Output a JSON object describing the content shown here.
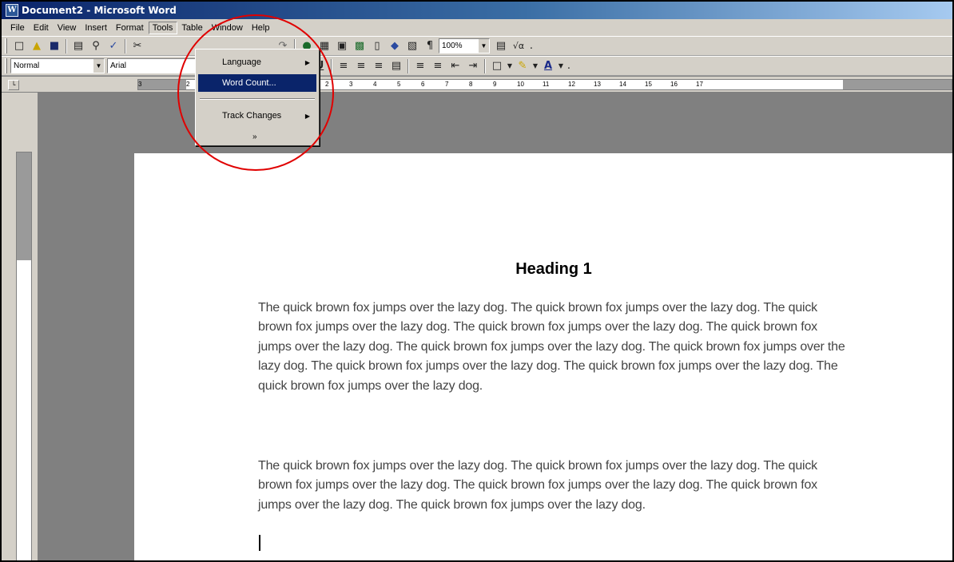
{
  "window": {
    "title": "Document2 - Microsoft Word",
    "app_icon": "word-doc-icon"
  },
  "menubar": {
    "items": [
      "File",
      "Edit",
      "View",
      "Insert",
      "Format",
      "Tools",
      "Table",
      "Window",
      "Help"
    ],
    "active": "Tools"
  },
  "toolbar_standard": {
    "buttons": [
      "new-icon",
      "open-icon",
      "save-icon",
      "print-icon",
      "print-preview-icon",
      "spelling-icon",
      "cut-icon",
      "undo-icon",
      "redo-icon",
      "hyperlink-icon",
      "tables-borders-icon",
      "insert-table-icon",
      "insert-excel-icon",
      "columns-icon",
      "drawing-icon",
      "document-map-icon",
      "show-hide-icon",
      "help-icon",
      "equation-icon"
    ],
    "zoom": "100%",
    "paragraph_mark": "¶"
  },
  "toolbar_formatting": {
    "style": "Normal",
    "font": "Arial",
    "buttons": [
      "underline-icon",
      "align-left-icon",
      "align-center-icon",
      "align-right-icon",
      "justify-icon",
      "numbering-icon",
      "bullets-icon",
      "decrease-indent-icon",
      "increase-indent-icon",
      "borders-icon",
      "highlight-icon",
      "font-color-icon"
    ]
  },
  "tools_menu": {
    "items": [
      {
        "label": "Language",
        "submenu": true,
        "highlighted": false
      },
      {
        "label": "Word Count...",
        "submenu": false,
        "highlighted": true
      },
      {
        "label": "Track Changes",
        "submenu": true,
        "highlighted": false
      }
    ],
    "expand_more": "»"
  },
  "ruler": {
    "ticks": [
      "3",
      "2",
      "1",
      "2",
      "3",
      "4",
      "5",
      "6",
      "7",
      "8",
      "9",
      "10",
      "11",
      "12",
      "13",
      "14",
      "15",
      "16",
      "17"
    ]
  },
  "document": {
    "heading": "Heading 1",
    "paragraphs": [
      "The quick brown fox jumps over the lazy dog.  The quick brown fox jumps over the lazy dog.  The quick brown fox jumps over the lazy dog.  The quick brown fox jumps over the lazy dog.  The quick brown fox jumps over the lazy dog.  The quick brown fox jumps over the lazy dog.  The quick brown fox jumps over the lazy dog.  The quick brown fox jumps over the lazy dog.  The quick brown fox jumps over the lazy dog.  The quick brown fox jumps over the lazy dog.",
      "The quick brown fox jumps over the lazy dog.  The quick brown fox jumps over the lazy dog.  The quick brown fox jumps over the lazy dog.  The quick brown fox jumps over the lazy dog.  The quick brown fox jumps over the lazy dog.  The quick brown fox jumps over the lazy dog."
    ]
  },
  "colors": {
    "highlight_circle": "#e00000",
    "menu_highlight": "#0a246a",
    "chrome": "#d4d0c8"
  }
}
